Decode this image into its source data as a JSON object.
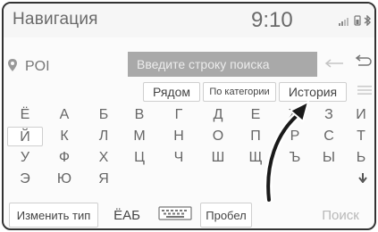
{
  "statusbar": {
    "title": "Навигация",
    "time": "9:10"
  },
  "search": {
    "poi_label": "POI",
    "placeholder": "Введите строку поиска"
  },
  "tabs": {
    "nearby": "Рядом",
    "by_category": "По категории",
    "history": "История"
  },
  "keyboard": {
    "rows": [
      [
        "Ё",
        "А",
        "Б",
        "В",
        "Г",
        "Д",
        "Е",
        "Ж",
        "З",
        "И"
      ],
      [
        "Й",
        "К",
        "Л",
        "М",
        "Н",
        "О",
        "П",
        "Р",
        "С",
        "Т"
      ],
      [
        "У",
        "Ф",
        "Х",
        "Ц",
        "Ч",
        "Ш",
        "Щ",
        "Ъ",
        "Ы",
        "Ь"
      ],
      [
        "Э",
        "Ю",
        "Я"
      ]
    ]
  },
  "bottom": {
    "change_type": "Изменить тип",
    "alphabet": "ЁАБ",
    "space": "Пробел",
    "search": "Поиск"
  },
  "colors": {
    "search_field_bg": "#a9a9a9",
    "text": "#666666",
    "disabled": "#b8b8b8"
  }
}
